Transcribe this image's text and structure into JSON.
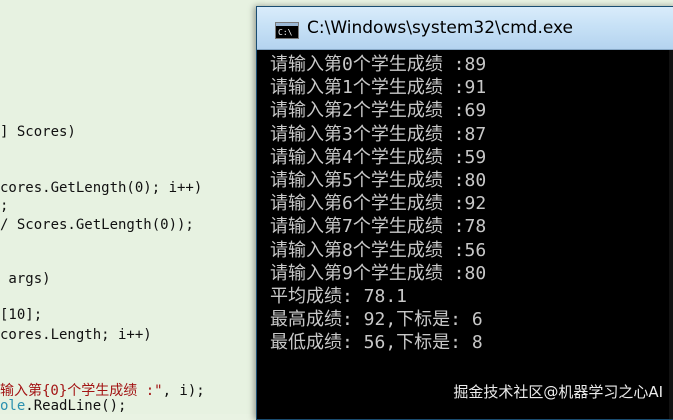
{
  "editor": {
    "lines": [
      {
        "text": "] Scores)",
        "segments": null
      },
      {
        "text": "cores.GetLength(0); i++)",
        "segments": null
      },
      {
        "text": ";",
        "segments": null
      },
      {
        "text": "/ Scores.GetLength(0));",
        "segments": null
      },
      {
        "text": " args)",
        "segments": null
      },
      {
        "text": "[10];",
        "segments": null
      },
      {
        "text": "cores.Length; i++)",
        "segments": null
      }
    ],
    "string_line": {
      "str": "输入第{0}个学生成绩 :\"",
      "rest": ", i);"
    },
    "last_line": {
      "prefix": "ole",
      "rest": ".ReadLine();"
    }
  },
  "window": {
    "icon_label": "C:\\",
    "title": "C:\\Windows\\system32\\cmd.exe"
  },
  "console": {
    "lines": [
      "请输入第0个学生成绩 :89",
      "请输入第1个学生成绩 :91",
      "请输入第2个学生成绩 :69",
      "请输入第3个学生成绩 :87",
      "请输入第4个学生成绩 :59",
      "请输入第5个学生成绩 :80",
      "请输入第6个学生成绩 :92",
      "请输入第7个学生成绩 :78",
      "请输入第8个学生成绩 :56",
      "请输入第9个学生成绩 :80",
      "平均成绩: 78.1",
      "最高成绩: 92,下标是: 6",
      "最低成绩: 56,下标是: 8"
    ]
  },
  "watermark": "掘金技术社区@机器学习之心AI"
}
